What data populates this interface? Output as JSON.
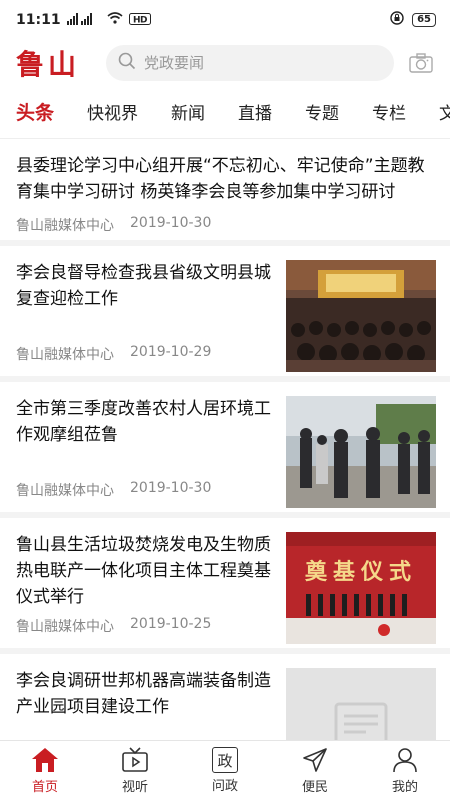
{
  "status": {
    "time": "11:11",
    "signal1": "⁴ᴳ",
    "signal2": "HD",
    "battery": "65"
  },
  "header": {
    "logo": "鲁山",
    "search_placeholder": "党政要闻"
  },
  "tabs": [
    "头条",
    "快视界",
    "新闻",
    "直播",
    "专题",
    "专栏",
    "文化"
  ],
  "feed": [
    {
      "title": "县委理论学习中心组开展“不忘初心、牢记使命”主题教育集中学习研讨 杨英锋李会良等参加集中学习研讨",
      "source": "鲁山融媒体中心",
      "date": "2019-10-30"
    },
    {
      "title": "李会良督导检查我县省级文明县城复查迎检工作",
      "source": "鲁山融媒体中心",
      "date": "2019-10-29"
    },
    {
      "title": "全市第三季度改善农村人居环境工作观摩组莅鲁",
      "source": "鲁山融媒体中心",
      "date": "2019-10-30"
    },
    {
      "title": "鲁山县生活垃圾焚烧发电及生物质热电联产一体化项目主体工程奠基仪式举行",
      "source": "鲁山融媒体中心",
      "date": "2019-10-25",
      "image_caption": "奠基仪式"
    },
    {
      "title": "李会良调研世邦机器高端装备制造产业园项目建设工作",
      "source": "",
      "date": ""
    }
  ],
  "tabbar": [
    {
      "label": "首页",
      "icon": "home-icon"
    },
    {
      "label": "视听",
      "icon": "tv-icon"
    },
    {
      "label": "问政",
      "icon": "wenzheng-icon",
      "glyph": "政"
    },
    {
      "label": "便民",
      "icon": "send-icon"
    },
    {
      "label": "我的",
      "icon": "user-icon"
    }
  ],
  "colors": {
    "accent": "#c91d22"
  }
}
